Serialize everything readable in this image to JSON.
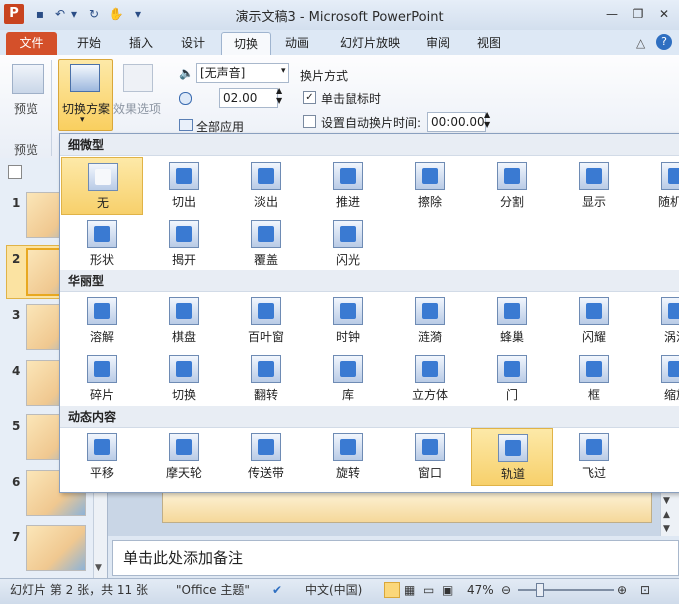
{
  "window": {
    "title": "演示文稿3 - Microsoft PowerPoint",
    "app_icon": "P"
  },
  "quick_access": [
    "save-icon",
    "undo-icon",
    "redo-icon",
    "repeat-icon",
    "customize-icon"
  ],
  "tabs": [
    "文件",
    "开始",
    "插入",
    "设计",
    "切换",
    "动画",
    "幻灯片放映",
    "审阅",
    "视图"
  ],
  "active_tab": "切换",
  "ribbon": {
    "preview_button": "预览",
    "preview_group": "预览",
    "scheme_button": "切换方案",
    "effect_button": "效果选项",
    "sound_value": "[无声音]",
    "duration_value": "02.00",
    "apply_all": "全部应用",
    "advance_title": "换片方式",
    "on_click_label": "单击鼠标时",
    "on_click_checked": true,
    "auto_label": "设置自动换片时间:",
    "auto_checked": false,
    "auto_value": "00:00.00"
  },
  "gallery": {
    "sections": [
      {
        "title": "细微型",
        "items": [
          "无",
          "切出",
          "淡出",
          "推进",
          "擦除",
          "分割",
          "显示",
          "随机线",
          "形状",
          "揭开",
          "覆盖",
          "闪光"
        ]
      },
      {
        "title": "华丽型",
        "items": [
          "溶解",
          "棋盘",
          "百叶窗",
          "时钟",
          "涟漪",
          "蜂巢",
          "闪耀",
          "涡流",
          "碎片",
          "切换",
          "翻转",
          "库",
          "立方体",
          "门",
          "框",
          "缩放"
        ]
      },
      {
        "title": "动态内容",
        "items": [
          "平移",
          "摩天轮",
          "传送带",
          "旋转",
          "窗口",
          "轨道",
          "飞过"
        ]
      }
    ],
    "selected_subtle": "无",
    "hovered_dynamic": "轨道"
  },
  "thumbnails": [
    "1",
    "2",
    "3",
    "4",
    "5",
    "6",
    "7"
  ],
  "selected_slide": "2",
  "notes_placeholder": "单击此处添加备注",
  "status": {
    "slide_info": "幻灯片 第 2 张，共 11 张",
    "theme": "\"Office 主题\"",
    "language": "中文(中国)",
    "zoom": "47%"
  },
  "colors": {
    "file_tab": "#d4502a",
    "selected": "#f9cf5f",
    "accent": "#3a7ad2"
  }
}
